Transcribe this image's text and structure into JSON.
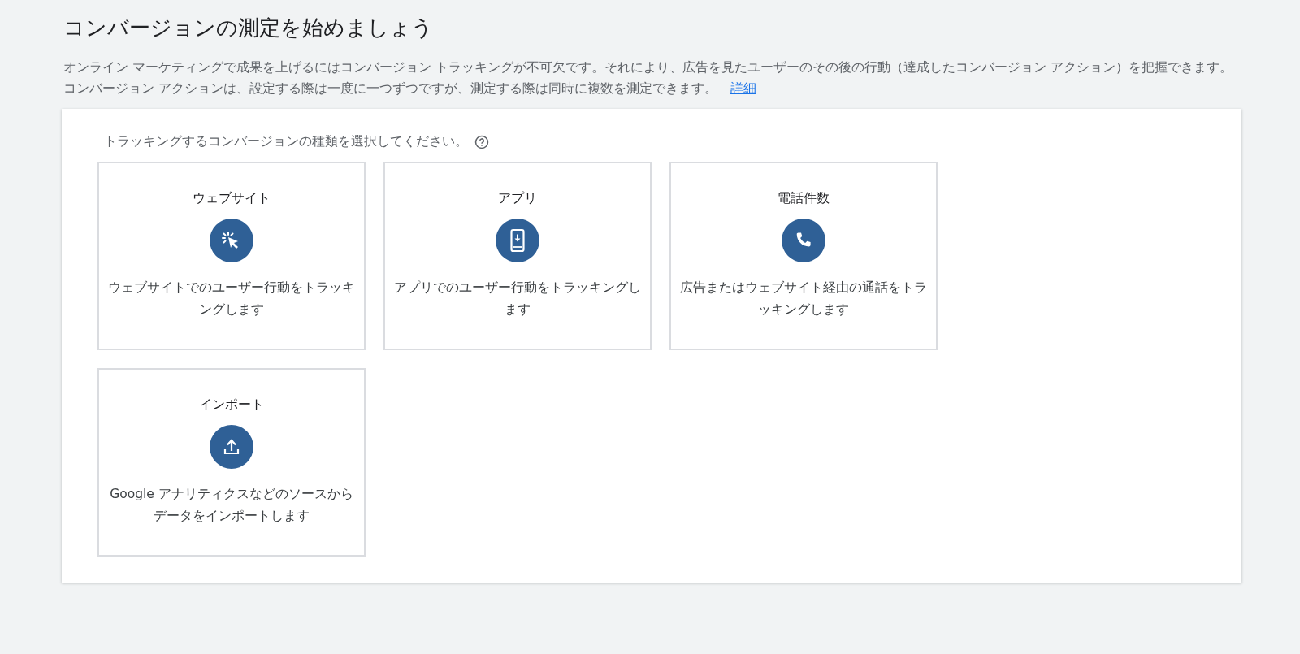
{
  "title": "コンバージョンの測定を始めましょう",
  "description": {
    "text": "オンライン マーケティングで成果を上げるにはコンバージョン トラッキングが不可欠です。それにより、広告を見たユーザーのその後の行動（達成したコンバージョン アクション）を把握できます。コンバージョン アクションは、設定する際は一度に一つずつですが、測定する際は同時に複数を測定できます。",
    "link": "詳細"
  },
  "panel": {
    "prompt": "トラッキングするコンバージョンの種類を選択してください。",
    "options": [
      {
        "kind": "website",
        "label": "ウェブサイト",
        "description": "ウェブサイトでのユーザー行動をトラッキングします"
      },
      {
        "kind": "app",
        "label": "アプリ",
        "description": "アプリでのユーザー行動をトラッキングします"
      },
      {
        "kind": "phone",
        "label": "電話件数",
        "description": "広告またはウェブサイト経由の通話をトラッキングします"
      },
      {
        "kind": "import",
        "label": "インポート",
        "description": "Google アナリティクスなどのソースからデータをインポートします"
      }
    ]
  }
}
